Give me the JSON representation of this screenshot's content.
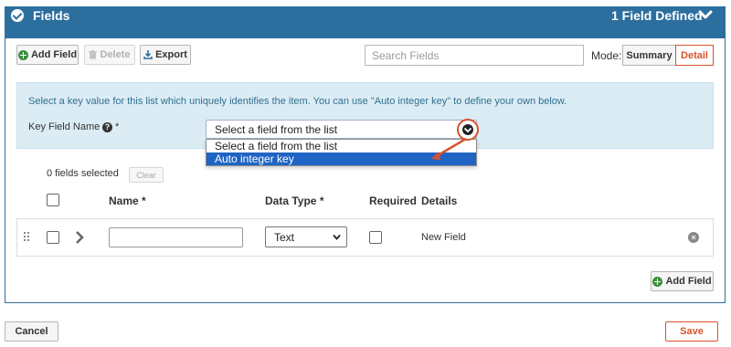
{
  "header": {
    "title": "Fields",
    "count_text": "1 Field Defined"
  },
  "toolbar": {
    "add_field_label": "Add Field",
    "delete_label": "Delete",
    "export_label": "Export",
    "search_placeholder": "Search Fields",
    "mode_label": "Mode:",
    "mode_summary_label": "Summary",
    "mode_detail_label": "Detail",
    "active_mode": "Detail"
  },
  "key_panel": {
    "info_text": "Select a key value for this list which uniquely identifies the item. You can use \"Auto integer key\" to define your own below.",
    "key_field_label": "Key Field Name",
    "required_mark": "*",
    "help_glyph": "?",
    "selected_value": "Select a field from the list",
    "options": [
      "Select a field from the list",
      "Auto integer key"
    ],
    "highlighted_option": "Auto integer key"
  },
  "fields_table": {
    "selected_count_text": "0 fields selected",
    "clear_label": "Clear",
    "columns": {
      "name": "Name",
      "name_required": "*",
      "data_type": "Data Type",
      "data_type_required": "*",
      "required": "Required",
      "details": "Details"
    },
    "rows": [
      {
        "name_value": "",
        "data_type": "Text",
        "required": false,
        "details": "New Field"
      }
    ],
    "add_field_label": "Add Field",
    "remove_glyph": "×"
  },
  "footer": {
    "cancel_label": "Cancel",
    "save_label": "Save"
  },
  "colors": {
    "header_bg": "#2c6f9e",
    "accent": "#d9522c",
    "info_bg": "#dbecf5",
    "highlight": "#1f64c4",
    "add_icon": "#3b8f3b"
  },
  "icons": {
    "header_status": "check-circle-icon",
    "collapse": "chevron-down-icon",
    "add": "plus-circle-icon",
    "delete": "trash-icon",
    "export": "download-icon",
    "help": "question-circle-icon",
    "drag": "drag-handle-icon",
    "expand_row": "chevron-right-icon",
    "remove": "remove-circle-icon"
  }
}
